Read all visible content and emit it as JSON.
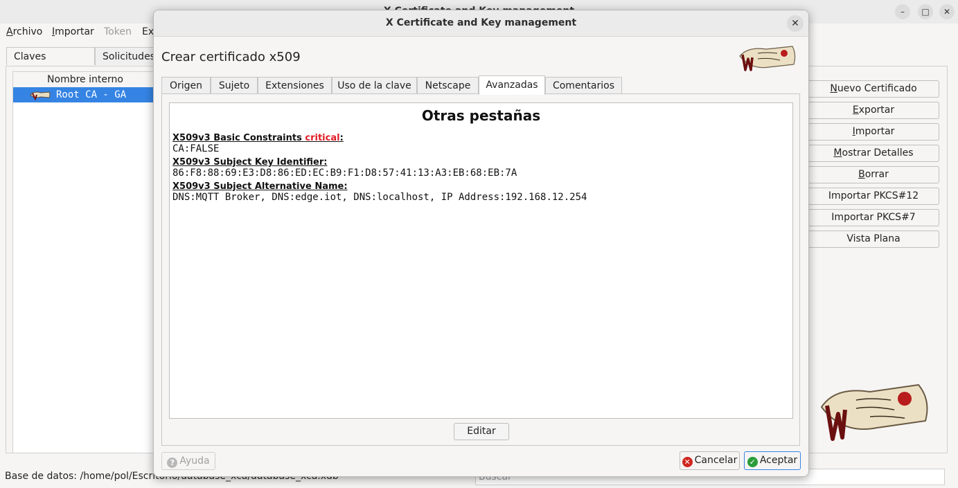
{
  "main": {
    "title": "X Certificate and Key management",
    "window_controls": [
      "–",
      "□",
      "✕"
    ],
    "menu": [
      {
        "label": "Archivo",
        "enabled": true
      },
      {
        "label": "Importar",
        "enabled": true
      },
      {
        "label": "Token",
        "enabled": false
      },
      {
        "label": "Ex",
        "enabled": true
      }
    ],
    "tabs": [
      "Claves Privadas",
      "Solicitudes"
    ],
    "tree": {
      "column_header": "Nombre interno",
      "rows": [
        "Root CA - GA"
      ]
    },
    "side_buttons": [
      "Nuevo Certificado",
      "Exportar",
      "Importar",
      "Mostrar Detalles",
      "Borrar",
      "Importar PKCS#12",
      "Importar PKCS#7",
      "Vista Plana"
    ],
    "status": "Base de datos: /home/pol/Escritorio/database_xca/database_xca.xdb",
    "search_placeholder": "Buscar"
  },
  "dialog": {
    "title": "X Certificate and Key management",
    "close_glyph": "✕",
    "heading": "Crear certificado x509",
    "tabs": [
      "Origen",
      "Sujeto",
      "Extensiones",
      "Uso de la clave",
      "Netscape",
      "Avanzadas",
      "Comentarios"
    ],
    "active_tab": "Avanzadas",
    "content": {
      "title": "Otras pestañas",
      "extensions": [
        {
          "label": "X509v3 Basic Constraints",
          "critical_text": "critical",
          "suffix": ":",
          "value": "CA:FALSE"
        },
        {
          "label": "X509v3 Subject Key Identifier:",
          "value": "86:F8:88:69:E3:D8:86:ED:EC:B9:F1:D8:57:41:13:A3:EB:68:EB:7A"
        },
        {
          "label": "X509v3 Subject Alternative Name:",
          "value": "DNS:MQTT Broker, DNS:edge.iot, DNS:localhost, IP Address:192.168.12.254"
        }
      ]
    },
    "edit_button": "Editar",
    "help_button": "Ayuda",
    "cancel_button": "Cancelar",
    "ok_button": "Aceptar",
    "colors": {
      "critical": "#e01b24",
      "selection": "#3584e4",
      "ok_icon": "#2a9d3a",
      "cancel_icon": "#d0261e"
    }
  }
}
